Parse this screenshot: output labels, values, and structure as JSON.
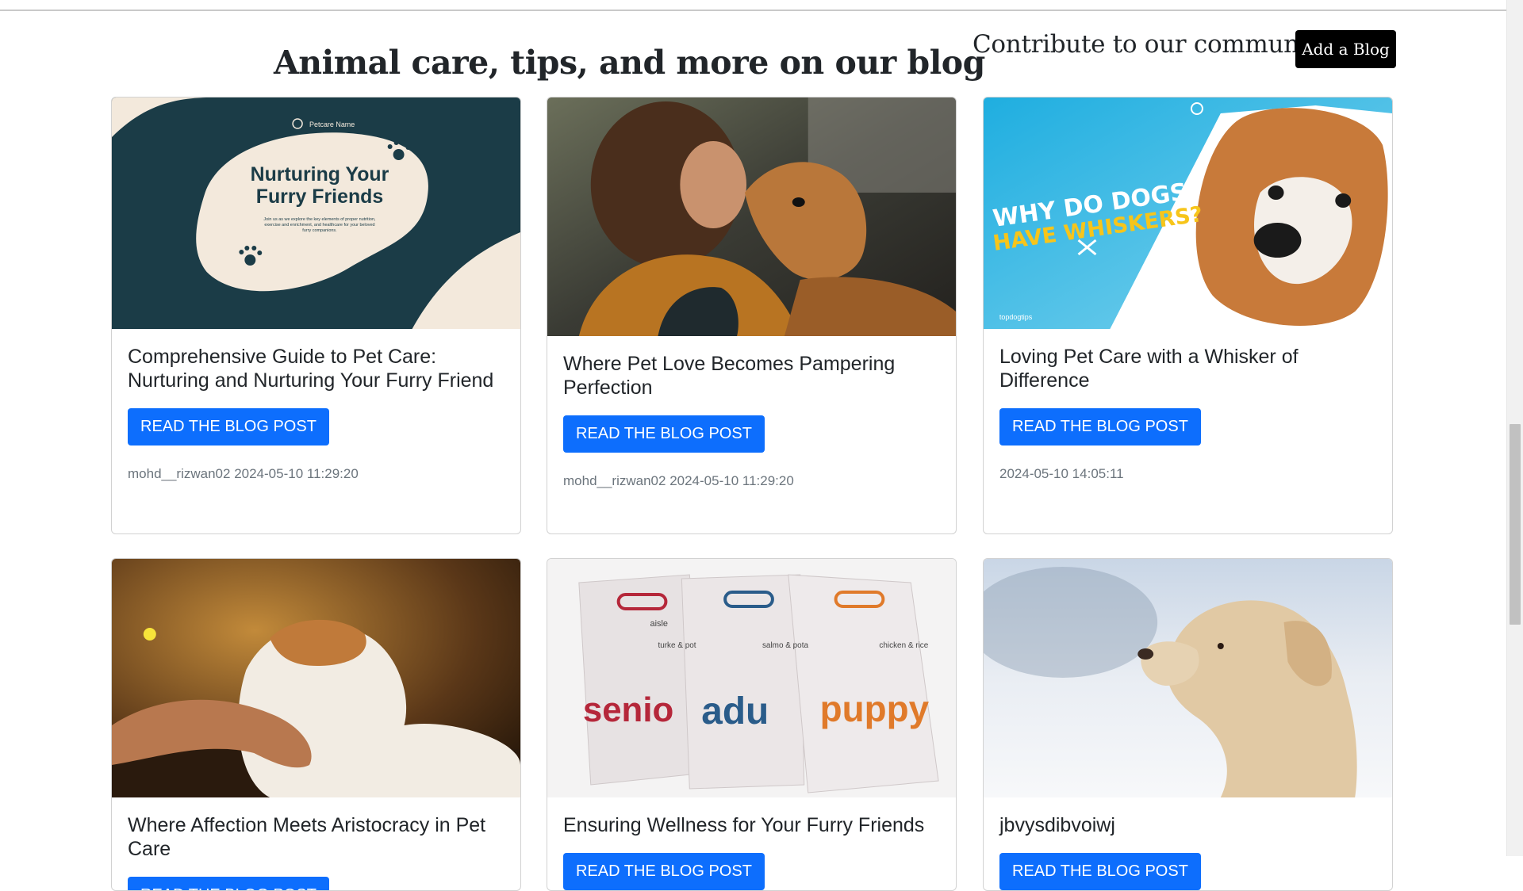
{
  "header": {
    "heading": "Animal care, tips, and more on our blog",
    "contribute_text": "Contribute to our community",
    "add_blog_label": "Add a Blog"
  },
  "cards": [
    {
      "title": "Comprehensive Guide to Pet Care: Nurturing and Nurturing Your Furry Friend",
      "button_label": "READ THE BLOG POST",
      "meta": "mohd__rizwan02 2024-05-10 11:29:20",
      "image": {
        "brand": "Petcare Name",
        "headline_1": "Nurturing Your",
        "headline_2": "Furry Friends",
        "body_1": "Join us as we explore the key elements of proper nutrition,",
        "body_2": "exercise and enrichment, and healthcare for your beloved",
        "body_3": "furry companions."
      }
    },
    {
      "title": "Where Pet Love Becomes Pampering Perfection",
      "button_label": "READ THE BLOG POST",
      "meta": "mohd__rizwan02 2024-05-10 11:29:20"
    },
    {
      "title": "Loving Pet Care with a Whisker of Difference",
      "button_label": "READ THE BLOG POST",
      "meta": "2024-05-10 14:05:11",
      "image": {
        "line_1": "WHY DO DOGS",
        "line_2": "HAVE WHISKERS?",
        "watermark": "topdogtips"
      }
    },
    {
      "title": "Where Affection Meets Aristocracy in Pet Care",
      "button_label": "READ THE BLOG POST",
      "meta": ""
    },
    {
      "title": "Ensuring Wellness for Your Furry Friends",
      "button_label": "READ THE BLOG POST",
      "meta": "",
      "image": {
        "bag_1": "senio",
        "bag_2": "adu",
        "bag_3": "puppy",
        "brand": "aisle",
        "flavor_1": "turke & pot",
        "flavor_2": "salmo & pota",
        "flavor_3": "chicken & rice"
      }
    },
    {
      "title": "jbvysdibvoiwj",
      "button_label": "READ THE BLOG POST",
      "meta": ""
    }
  ],
  "colors": {
    "primary_button": "#0d6efd",
    "add_blog_button": "#000000",
    "card1_bg": "#1b3c47",
    "card1_blob": "#f3e9dc"
  }
}
